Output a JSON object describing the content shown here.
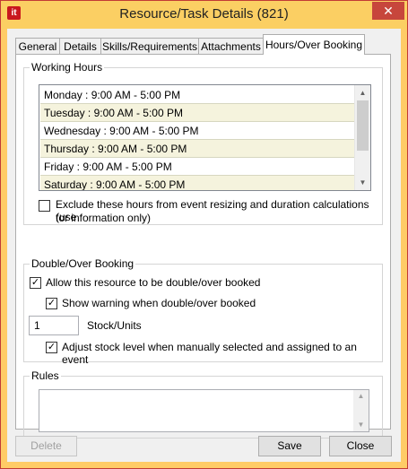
{
  "window": {
    "app_icon_text": "it",
    "title": "Resource/Task Details (821)",
    "close_symbol": "✕"
  },
  "tabs": [
    {
      "label": "General"
    },
    {
      "label": "Details"
    },
    {
      "label": "Skills/Requirements"
    },
    {
      "label": "Attachments"
    },
    {
      "label": "Hours/Over Booking"
    }
  ],
  "working_hours": {
    "legend": "Working Hours",
    "rows": [
      {
        "text": "Monday :   9:00 AM - 5:00 PM"
      },
      {
        "text": "Tuesday :   9:00 AM - 5:00 PM"
      },
      {
        "text": "Wednesday :   9:00 AM - 5:00 PM"
      },
      {
        "text": "Thursday :   9:00 AM - 5:00 PM"
      },
      {
        "text": "Friday :   9:00 AM - 5:00 PM"
      },
      {
        "text": "Saturday :   9:00 AM - 5:00 PM"
      }
    ],
    "exclude_label_1": "Exclude these hours from event resizing and duration calculations (use",
    "exclude_label_2": "for information only)",
    "exclude_checked": false
  },
  "double_booking": {
    "legend": "Double/Over Booking",
    "allow_label": "Allow this resource to be double/over booked",
    "allow_checked": true,
    "warning_label": "Show warning when double/over booked",
    "warning_checked": true,
    "stock_value": "1",
    "stock_label": "Stock/Units",
    "adjust_label": "Adjust stock level when manually selected and assigned to an event",
    "adjust_checked": true
  },
  "rules": {
    "legend": "Rules",
    "value": ""
  },
  "footer": {
    "delete_label": "Delete",
    "save_label": "Save",
    "close_label": "Close"
  }
}
